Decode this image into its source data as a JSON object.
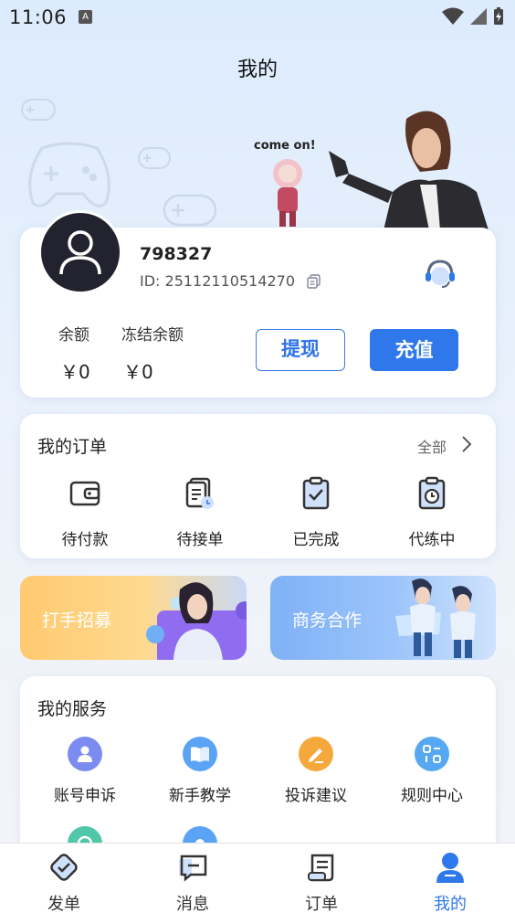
{
  "status_bar": {
    "time": "11:06",
    "indicator": "A"
  },
  "header": {
    "title": "我的"
  },
  "banner": {
    "slogan": "come on!"
  },
  "profile": {
    "username": "798327",
    "id_text": "ID: 25112110514270",
    "balance_label": "余额",
    "balance_value": "￥0",
    "frozen_label": "冻结余额",
    "frozen_value": "￥0",
    "withdraw_label": "提现",
    "recharge_label": "充值"
  },
  "orders": {
    "title": "我的订单",
    "all_label": "全部",
    "items": [
      {
        "label": "待付款",
        "icon": "wallet-icon"
      },
      {
        "label": "待接单",
        "icon": "pending-order-icon"
      },
      {
        "label": "已完成",
        "icon": "clipboard-check-icon"
      },
      {
        "label": "代练中",
        "icon": "clipboard-clock-icon"
      }
    ]
  },
  "promos": {
    "recruit_label": "打手招募",
    "business_label": "商务合作"
  },
  "services": {
    "title": "我的服务",
    "items": [
      {
        "label": "账号申诉",
        "icon": "account-appeal-icon",
        "color": "#7b8cf0"
      },
      {
        "label": "新手教学",
        "icon": "book-icon",
        "color": "#5aa3f5"
      },
      {
        "label": "投诉建议",
        "icon": "edit-icon",
        "color": "#f5a83b"
      },
      {
        "label": "规则中心",
        "icon": "rules-icon",
        "color": "#56a8f2"
      }
    ]
  },
  "tabs": [
    {
      "label": "发单",
      "icon": "checkmark-diamond-icon"
    },
    {
      "label": "消息",
      "icon": "message-icon"
    },
    {
      "label": "订单",
      "icon": "order-scroll-icon"
    },
    {
      "label": "我的",
      "icon": "user-icon",
      "active": true
    }
  ],
  "colors": {
    "accent": "#2f78eb",
    "background": "#e7f0fc"
  }
}
